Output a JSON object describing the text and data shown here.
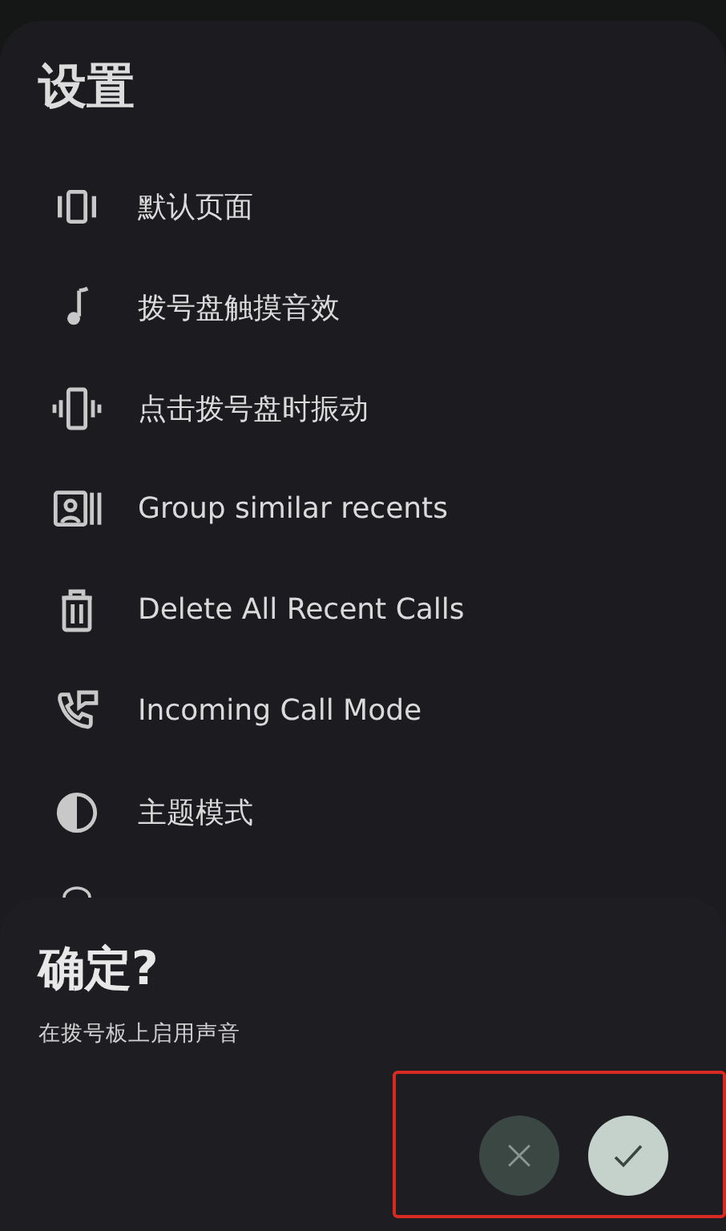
{
  "settings": {
    "title": "设置",
    "items": [
      {
        "label": "默认页面"
      },
      {
        "label": "拨号盘触摸音效"
      },
      {
        "label": "点击拨号盘时振动"
      },
      {
        "label": "Group similar recents"
      },
      {
        "label": "Delete All Recent Calls"
      },
      {
        "label": "Incoming Call Mode"
      },
      {
        "label": "主题模式"
      }
    ]
  },
  "dialog": {
    "title": "确定?",
    "message": "在拨号板上启用声音",
    "buttons": [
      {
        "kind": "cancel"
      },
      {
        "kind": "confirm"
      }
    ]
  }
}
